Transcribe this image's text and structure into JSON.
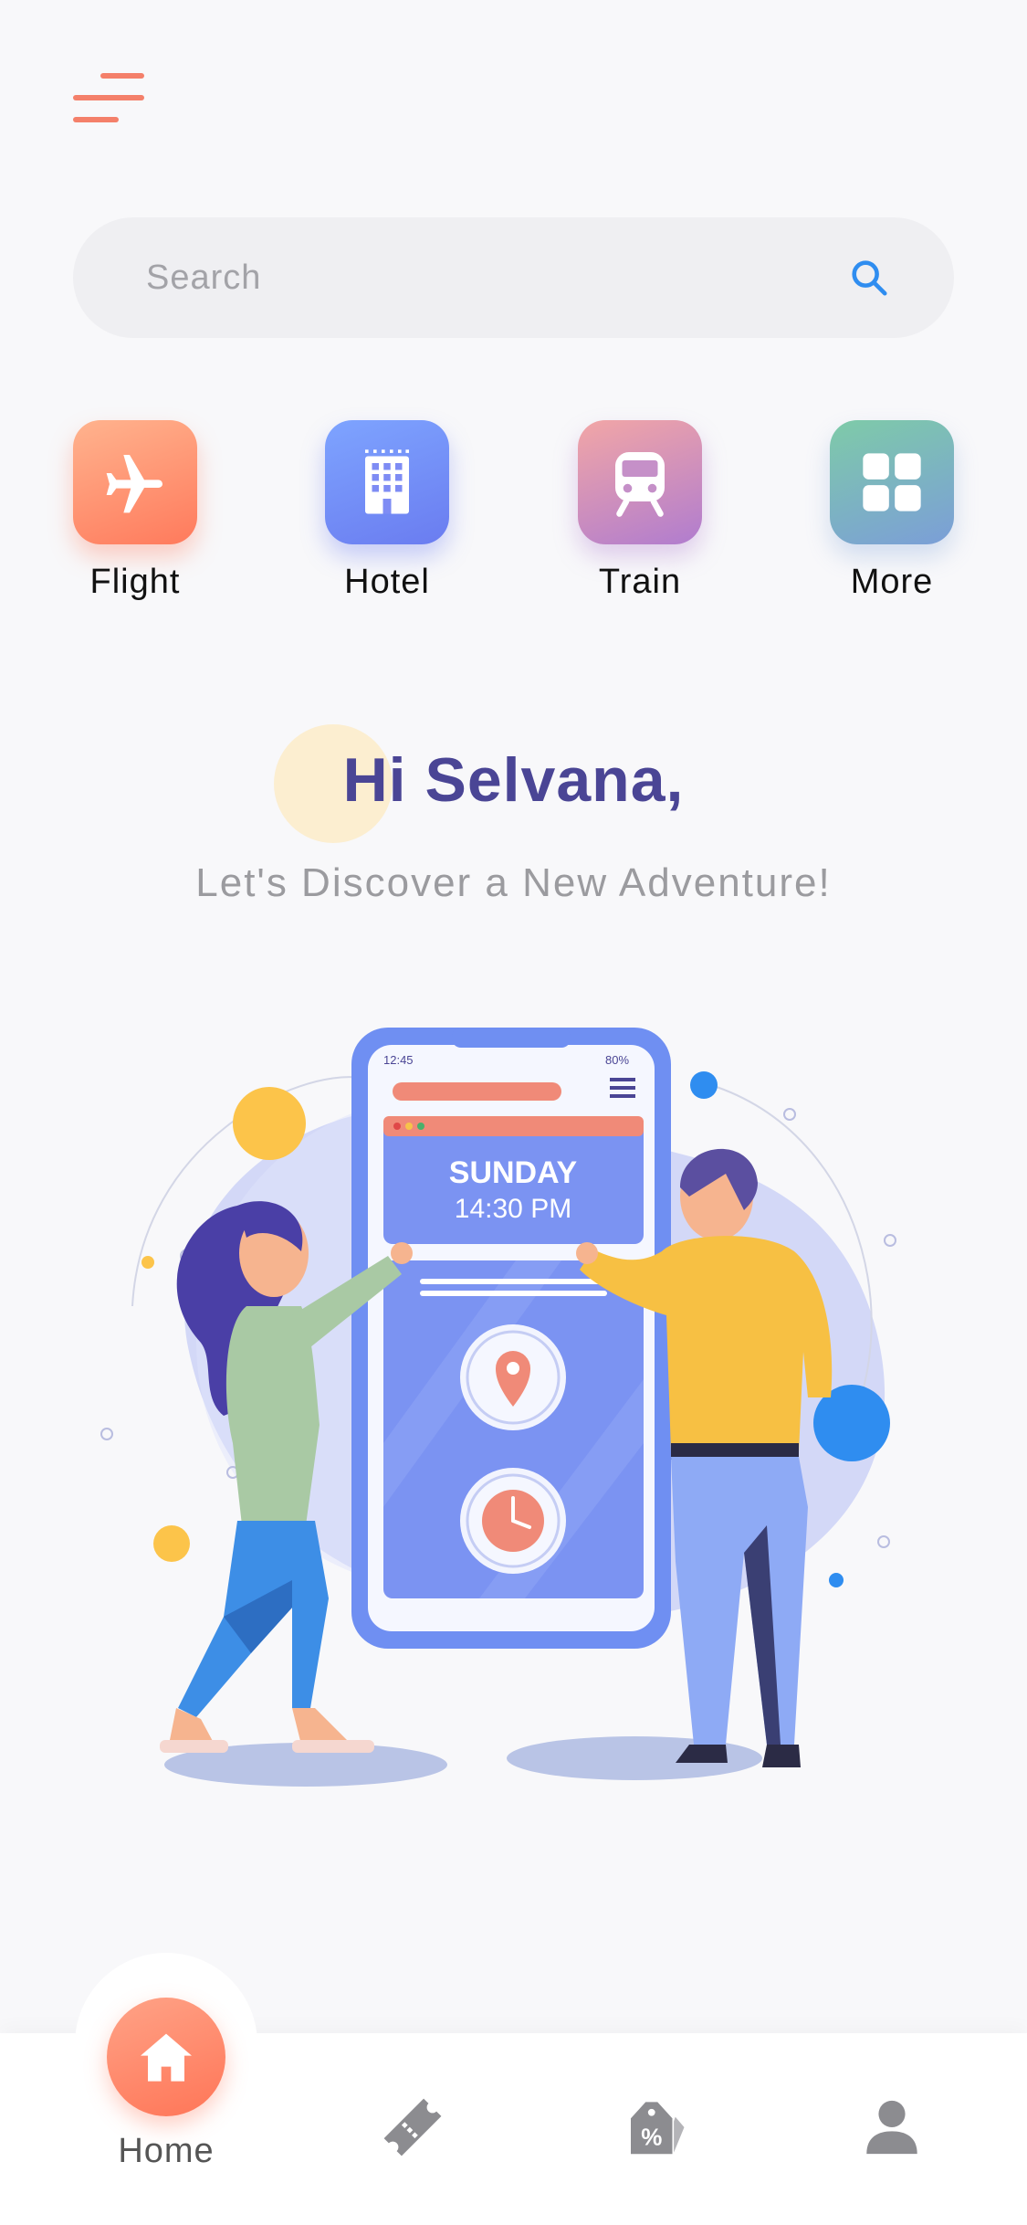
{
  "search": {
    "placeholder": "Search"
  },
  "categories": [
    {
      "label": "Flight",
      "icon": "airplane-icon"
    },
    {
      "label": "Hotel",
      "icon": "building-icon"
    },
    {
      "label": "Train",
      "icon": "train-icon"
    },
    {
      "label": "More",
      "icon": "grid-icon"
    }
  ],
  "greeting": {
    "title": "Hi Selvana,",
    "subtitle": "Let's Discover a New Adventure!"
  },
  "illustration": {
    "phone_time": "12:45",
    "phone_battery": "80%",
    "phone_day": "SUNDAY",
    "phone_clock": "14:30 PM"
  },
  "bottom_nav": {
    "home_label": "Home",
    "items": [
      "home-icon",
      "ticket-icon",
      "discount-tag-icon",
      "profile-icon"
    ]
  },
  "colors": {
    "accent": "#f4806a",
    "heading": "#4a4595",
    "search_icon": "#2f8df0",
    "background": "#f8f8fa"
  }
}
